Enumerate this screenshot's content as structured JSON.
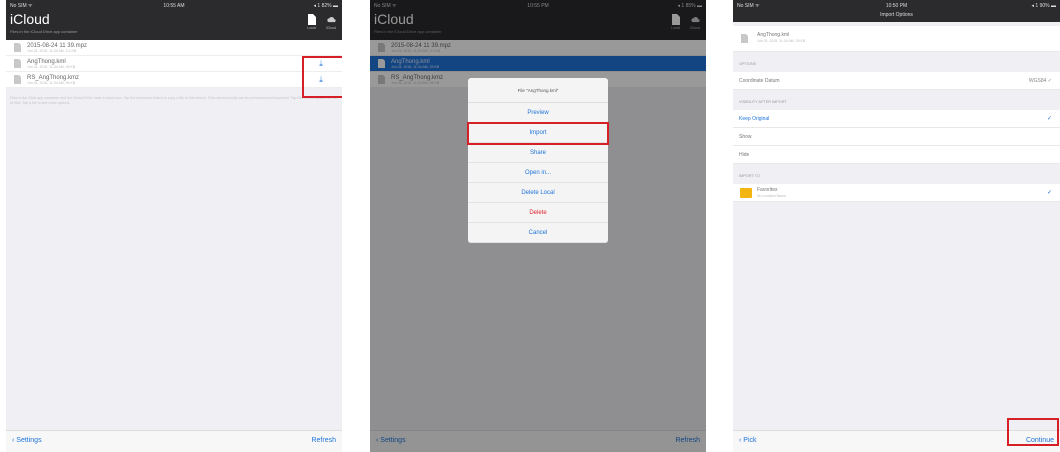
{
  "panel1": {
    "status": {
      "left": "No SIM ᯤ",
      "time": "10:55 AM",
      "right": "◂ 1 82% ▬"
    },
    "title": "iCloud",
    "subtitle": "Files in the iCloud Drive app container",
    "header_buttons": [
      {
        "label": "Local",
        "icon": "document-icon"
      },
      {
        "label": "iCloud",
        "icon": "cloud-icon"
      }
    ],
    "files": [
      {
        "name": "2015-08-24 11 39.mpz",
        "meta": "Jun 24, 2015, 11:39 AM, 3.4 KB"
      },
      {
        "name": "AngThong.kml",
        "meta": "Jun 24, 2015, 11:34 AM, 39 KB"
      },
      {
        "name": "RS_AngThong.kmz",
        "meta": "Jun 24, 2015, 11:34 AM, 95 KB"
      }
    ],
    "info": "Files in the Slots app container and the iCloud Drive have a cloud icon. Tap the download button to copy a file to this device. Files stored locally can be previewed and imported. Tap Refresh to update the list of files. Tap a file to see more options.",
    "toolbar": {
      "left": "‹ Settings",
      "right": "Refresh"
    }
  },
  "panel2": {
    "status": {
      "left": "No SIM ᯤ",
      "time": "10:55 PM",
      "right": "◂ 1 85% ▬"
    },
    "title": "iCloud",
    "subtitle": "Files in the iCloud Drive app container",
    "header_buttons": [
      {
        "label": "Local",
        "icon": "document-icon"
      },
      {
        "label": "iCloud",
        "icon": "cloud-icon"
      }
    ],
    "files": [
      {
        "name": "2015-08-24 11 39.mpz",
        "meta": "Jun 24, 2015, 11:39 AM, 3.4 KB"
      },
      {
        "name": "AngThong.kml",
        "meta": "Jun 24, 2015, 11:34 AM, 39 KB"
      },
      {
        "name": "RS_AngThong.kmz",
        "meta": "Jun 24, 2015, 11:34 AM, 95 KB"
      }
    ],
    "sheet": {
      "title": "File \"AngThong.kml\"",
      "items": [
        "Preview",
        "Import",
        "Share",
        "Open in...",
        "Delete Local",
        "Delete",
        "Cancel"
      ]
    },
    "toolbar": {
      "left": "‹ Settings",
      "right": "Refresh"
    }
  },
  "panel3": {
    "status": {
      "left": "No SIM ᯤ",
      "time": "10:50 PM",
      "right": "◂ 1 90% ▬"
    },
    "title": "Import Options",
    "file": {
      "name": "AngThong.kml",
      "meta": "Jun 24, 2015, 11:34 AM, 39 KB"
    },
    "sections": {
      "options": "OPTIONS",
      "visibility": "VISIBILITY AFTER IMPORT",
      "import_to": "IMPORT TO"
    },
    "datum_label": "Coordinate Datum",
    "datum_value": "WGS84 ✓",
    "visibility_items": [
      "Keep Original",
      "Show",
      "Hide"
    ],
    "visibility_check": "✓",
    "folder": {
      "name": "Favorites",
      "meta": "No Location Name"
    },
    "folder_check": "✓",
    "toolbar": {
      "left": "‹ Pick",
      "right": "Continue"
    }
  },
  "colors": {
    "accent": "#1e73d9",
    "highlight": "#d52027",
    "folder": "#f2b511"
  }
}
